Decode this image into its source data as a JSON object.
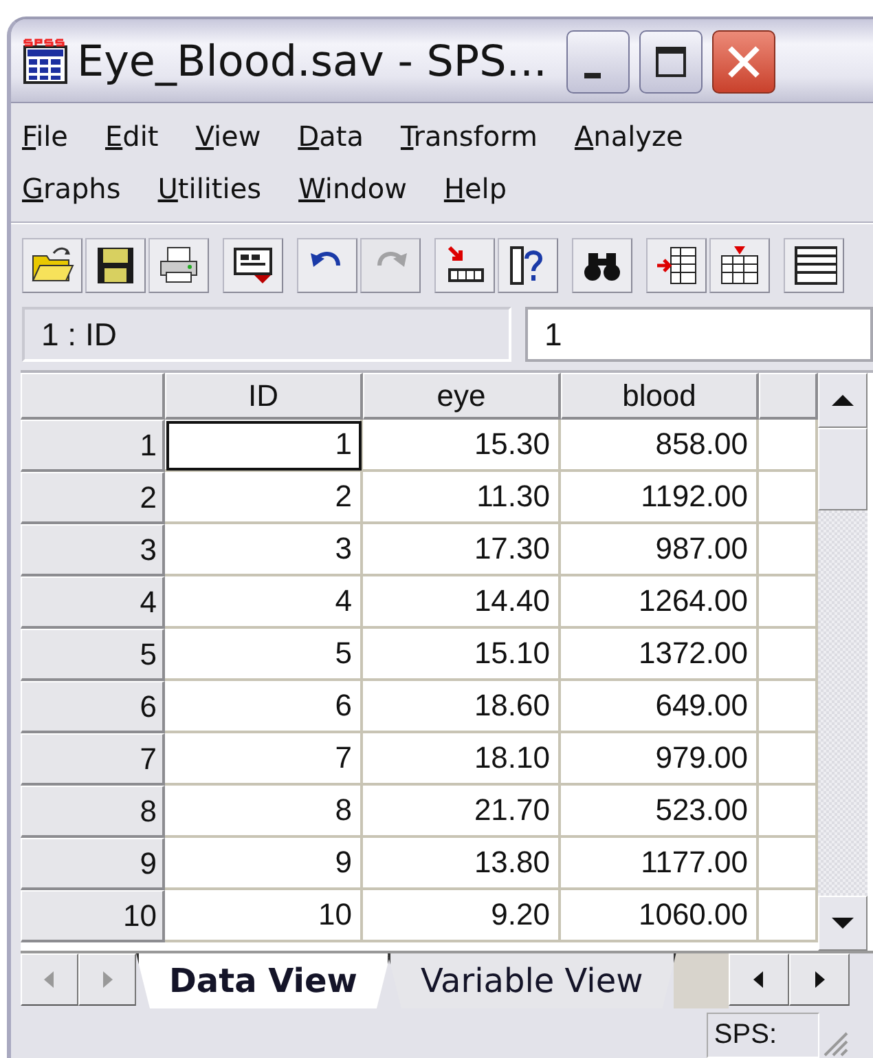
{
  "window": {
    "title": "Eye_Blood.sav - SPS..."
  },
  "menu_rows": [
    [
      "File",
      "Edit",
      "View",
      "Data",
      "Transform",
      "Analyze"
    ],
    [
      "Graphs",
      "Utilities",
      "Window",
      "Help"
    ]
  ],
  "toolbar": [
    {
      "kind": "open",
      "disabled": false
    },
    {
      "kind": "save",
      "disabled": false
    },
    {
      "kind": "print",
      "disabled": false
    },
    {
      "kind": "dialog",
      "disabled": false
    },
    {
      "kind": "undo",
      "disabled": false
    },
    {
      "kind": "redo",
      "disabled": true
    },
    {
      "kind": "goto-case",
      "disabled": false
    },
    {
      "kind": "variables",
      "disabled": false
    },
    {
      "kind": "find",
      "disabled": false
    },
    {
      "kind": "insert-case",
      "disabled": false
    },
    {
      "kind": "insert-variable",
      "disabled": false
    },
    {
      "kind": "split",
      "disabled": false
    }
  ],
  "cell_bar": {
    "reference": "1 : ID",
    "value": "1"
  },
  "table": {
    "columns": [
      "ID",
      "eye",
      "blood"
    ],
    "rows": [
      {
        "number": "1",
        "selected": true,
        "cells": [
          "1",
          "15.30",
          "858.00"
        ]
      },
      {
        "number": "2",
        "selected": false,
        "cells": [
          "2",
          "11.30",
          "1192.00"
        ]
      },
      {
        "number": "3",
        "selected": false,
        "cells": [
          "3",
          "17.30",
          "987.00"
        ]
      },
      {
        "number": "4",
        "selected": false,
        "cells": [
          "4",
          "14.40",
          "1264.00"
        ]
      },
      {
        "number": "5",
        "selected": false,
        "cells": [
          "5",
          "15.10",
          "1372.00"
        ]
      },
      {
        "number": "6",
        "selected": false,
        "cells": [
          "6",
          "18.60",
          "649.00"
        ]
      },
      {
        "number": "7",
        "selected": false,
        "cells": [
          "7",
          "18.10",
          "979.00"
        ]
      },
      {
        "number": "8",
        "selected": false,
        "cells": [
          "8",
          "21.70",
          "523.00"
        ]
      },
      {
        "number": "9",
        "selected": false,
        "cells": [
          "9",
          "13.80",
          "1177.00"
        ]
      },
      {
        "number": "10",
        "selected": false,
        "cells": [
          "10",
          "9.20",
          "1060.00"
        ]
      }
    ]
  },
  "tabs": [
    {
      "label": "Data View",
      "selected": true
    },
    {
      "label": "Variable View",
      "selected": false
    }
  ],
  "status_bar": {
    "text": "SPS:"
  }
}
